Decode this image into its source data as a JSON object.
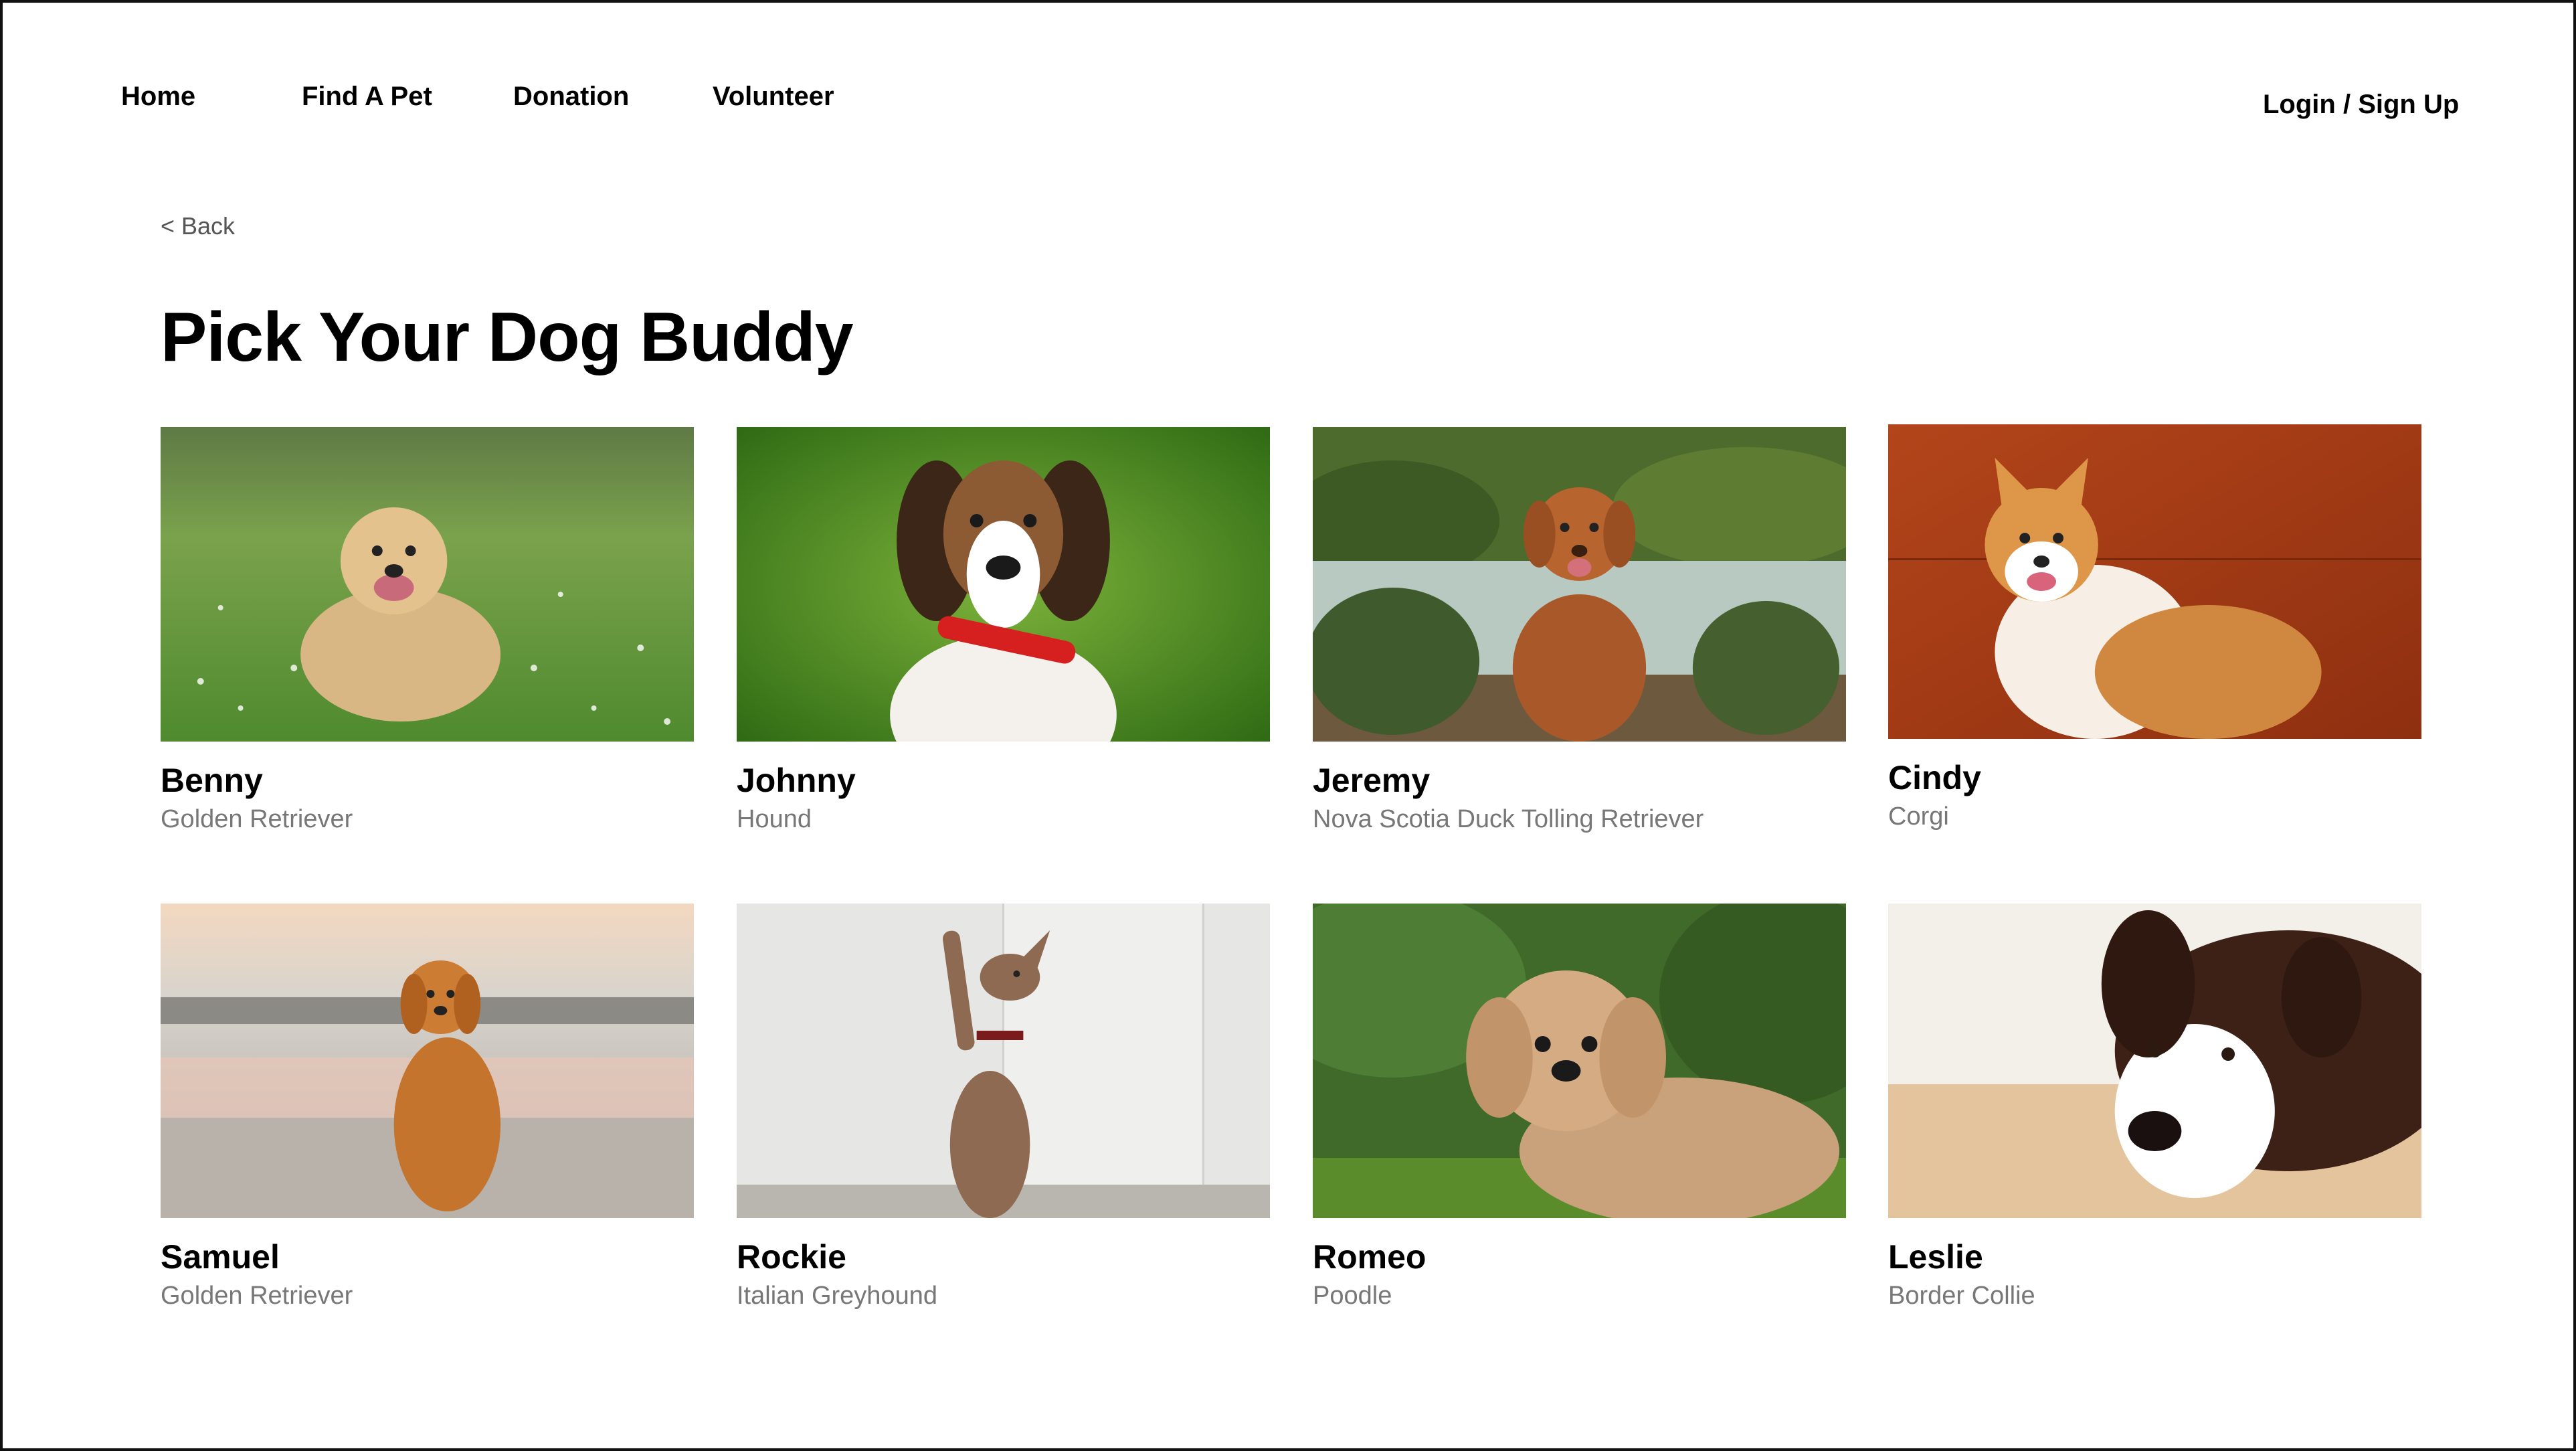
{
  "nav": {
    "home": "Home",
    "find_a_pet": "Find A Pet",
    "donation": "Donation",
    "volunteer": "Volunteer",
    "login": "Login / Sign Up"
  },
  "back_label": "< Back",
  "page_title": "Pick Your Dog Buddy",
  "pets": [
    {
      "name": "Benny",
      "breed": "Golden Retriever"
    },
    {
      "name": "Johnny",
      "breed": "Hound"
    },
    {
      "name": "Jeremy",
      "breed": "Nova Scotia Duck Tolling Retriever"
    },
    {
      "name": "Cindy",
      "breed": "Corgi"
    },
    {
      "name": "Samuel",
      "breed": "Golden Retriever"
    },
    {
      "name": "Rockie",
      "breed": "Italian Greyhound"
    },
    {
      "name": "Romeo",
      "breed": "Poodle"
    },
    {
      "name": "Leslie",
      "breed": "Border Collie"
    }
  ]
}
